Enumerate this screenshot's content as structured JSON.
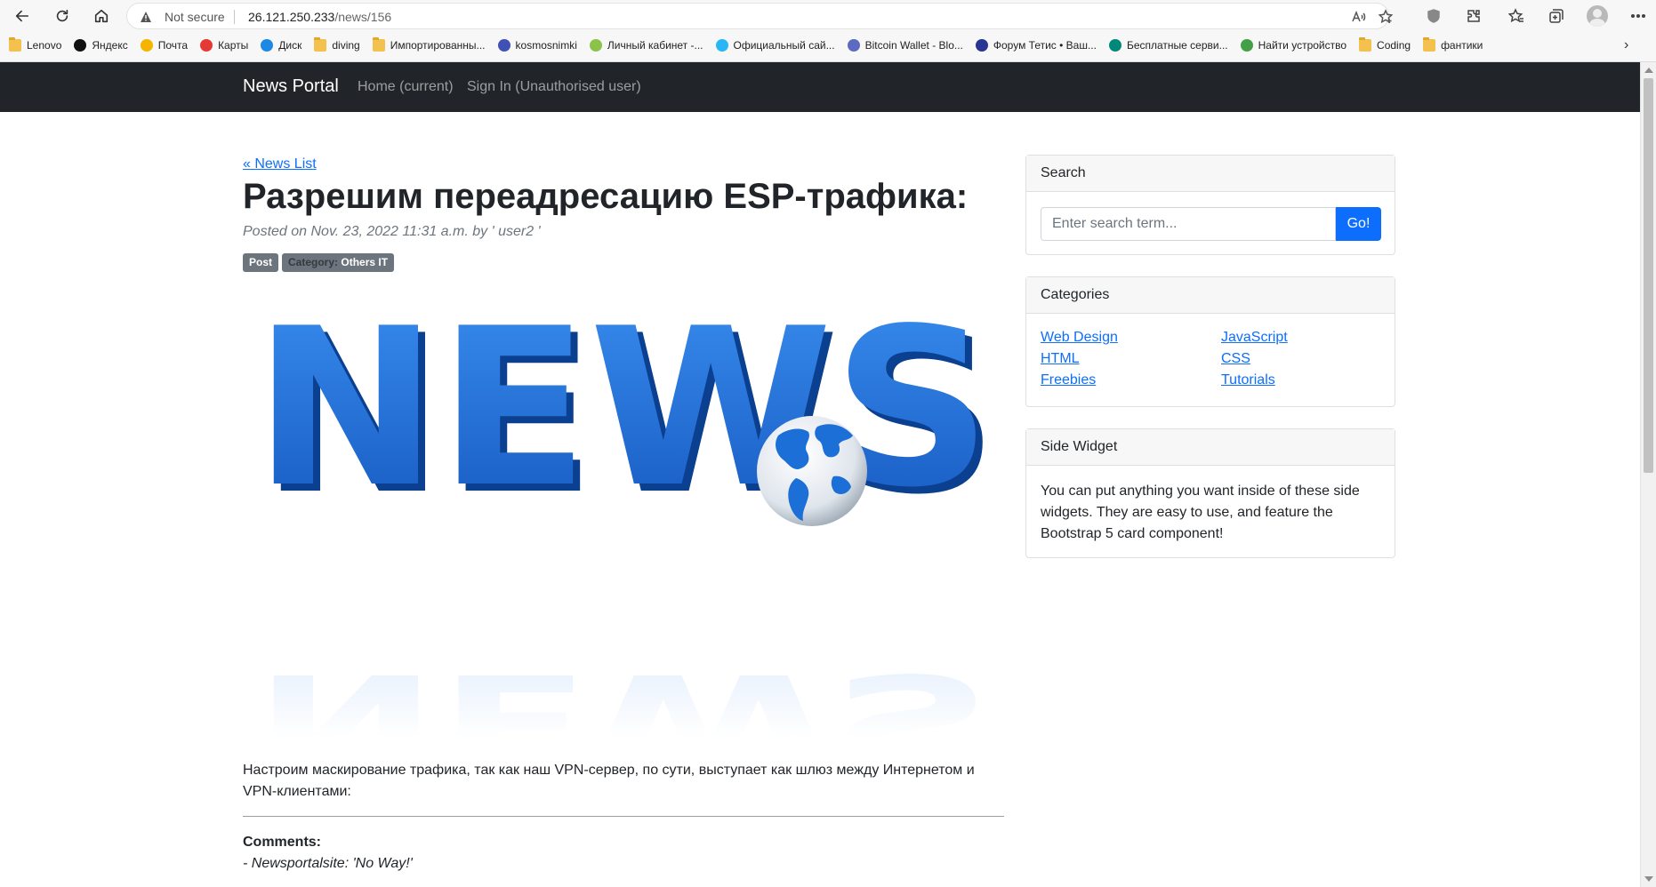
{
  "browser": {
    "security_label": "Not secure",
    "url_host": "26.121.250.233",
    "url_path": "/news/156",
    "bookmarks": [
      {
        "label": "Lenovo",
        "icon": "folder-icon"
      },
      {
        "label": "Яндекс",
        "icon": "yandex-icon"
      },
      {
        "label": "Почта",
        "icon": "mail-icon"
      },
      {
        "label": "Карты",
        "icon": "map-pin-icon"
      },
      {
        "label": "Диск",
        "icon": "disk-icon"
      },
      {
        "label": "diving",
        "icon": "folder-icon"
      },
      {
        "label": "Импортированны...",
        "icon": "folder-icon"
      },
      {
        "label": "kosmosnimki",
        "icon": "globe-icon"
      },
      {
        "label": "Личный кабинет -...",
        "icon": "emblem-icon"
      },
      {
        "label": "Официальный сай...",
        "icon": "site-icon"
      },
      {
        "label": "Bitcoin Wallet - Blo...",
        "icon": "cube-icon"
      },
      {
        "label": "Форум Тетис • Ваш...",
        "icon": "forum-icon"
      },
      {
        "label": "Бесплатные серви...",
        "icon": "k-icon"
      },
      {
        "label": "Найти устройство",
        "icon": "find-device-icon"
      },
      {
        "label": "Coding",
        "icon": "folder-icon"
      },
      {
        "label": "фантики",
        "icon": "folder-icon"
      }
    ]
  },
  "navbar": {
    "brand": "News Portal",
    "links": [
      "Home (current)",
      "Sign In (Unauthorised user)"
    ]
  },
  "post": {
    "back_link": "« News List",
    "title": "Разрешим переадресацию ESP-трафика:",
    "meta": "Posted on Nov. 23, 2022 11:31 a.m. by ' user2 '",
    "badge_type": "Post",
    "badge_category_label": "Category:",
    "badge_category_value": "Others IT",
    "hero_word": "NEWS",
    "body": "Настроим маскирование трафика, так как наш VPN-сервер, по сути, выступает как шлюз между Интернетом и VPN-клиентами:",
    "comments_heading": "Comments:",
    "comments": [
      "- Newsportalsite: 'No Way!'"
    ]
  },
  "sidebar": {
    "search": {
      "title": "Search",
      "placeholder": "Enter search term...",
      "button": "Go!"
    },
    "categories": {
      "title": "Categories",
      "left": [
        "Web Design",
        "HTML",
        "Freebies"
      ],
      "right": [
        "JavaScript",
        "CSS",
        "Tutorials"
      ]
    },
    "widget": {
      "title": "Side Widget",
      "text": "You can put anything you want inside of these side widgets. They are easy to use, and feature the Bootstrap 5 card component!"
    }
  },
  "colors": {
    "navbar_bg": "#212529",
    "link": "#0d6efd",
    "badge": "#6c757d",
    "news_blue": "#1b6fd6"
  }
}
